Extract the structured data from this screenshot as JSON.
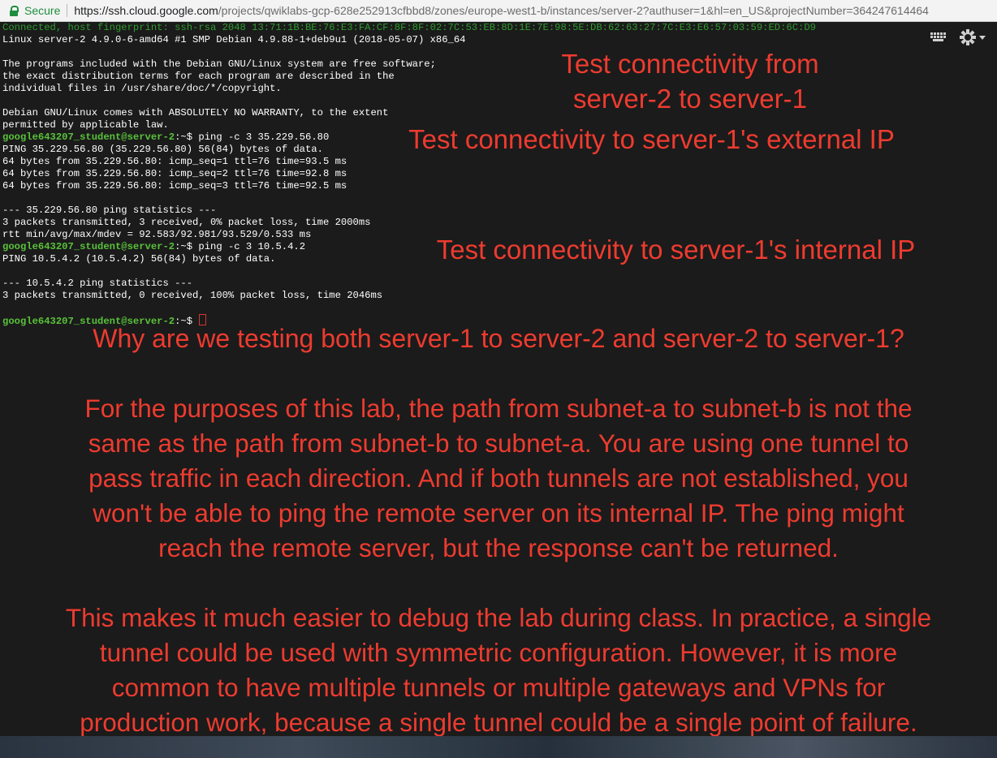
{
  "browser": {
    "secure_label": "Secure",
    "url_host": "https://ssh.cloud.google.com",
    "url_path": "/projects/qwiklabs-gcp-628e252913cfbbd8/zones/europe-west1-b/instances/server-2?authuser=1&hl=en_US&projectNumber=364247614464"
  },
  "terminal": {
    "fingerprint": "Connected, host fingerprint: ssh-rsa 2048 13:71:1B:BE:76:E3:FA:CF:8F:8F:02:7C:53:EB:8D:1E:7E:98:5E:DB:62:63:27:7C:E3:E6:57:03:59:ED:6C:D9",
    "uname": "Linux server-2 4.9.0-6-amd64 #1 SMP Debian 4.9.88-1+deb9u1 (2018-05-07) x86_64",
    "motd1": "The programs included with the Debian GNU/Linux system are free software;",
    "motd2": "the exact distribution terms for each program are described in the",
    "motd3": "individual files in /usr/share/doc/*/copyright.",
    "motd4": "Debian GNU/Linux comes with ABSOLUTELY NO WARRANTY, to the extent",
    "motd5": "permitted by applicable law.",
    "prompt": "google643207_student@server-2",
    "prompt_suffix": ":~$",
    "cmd1": " ping -c 3 35.229.56.80",
    "ping1_header": "PING 35.229.56.80 (35.229.56.80) 56(84) bytes of data.",
    "ping1_r1": "64 bytes from 35.229.56.80: icmp_seq=1 ttl=76 time=93.5 ms",
    "ping1_r2": "64 bytes from 35.229.56.80: icmp_seq=2 ttl=76 time=92.8 ms",
    "ping1_r3": "64 bytes from 35.229.56.80: icmp_seq=3 ttl=76 time=92.5 ms",
    "ping1_stats_head": "--- 35.229.56.80 ping statistics ---",
    "ping1_stats": "3 packets transmitted, 3 received, 0% packet loss, time 2000ms",
    "ping1_rtt": "rtt min/avg/max/mdev = 92.583/92.981/93.529/0.533 ms",
    "cmd2": " ping -c 3 10.5.4.2",
    "ping2_header": "PING 10.5.4.2 (10.5.4.2) 56(84) bytes of data.",
    "ping2_stats_head": "--- 10.5.4.2 ping statistics ---",
    "ping2_stats": "3 packets transmitted, 0 received, 100% packet loss, time 2046ms"
  },
  "annotations": {
    "title_line1": "Test connectivity from",
    "title_line2": "server-2 to server-1",
    "external": "Test connectivity to server-1's external IP",
    "internal": "Test connectivity to server-1's internal IP",
    "why": "Why are we testing both server-1 to server-2 and server-2 to server-1?",
    "para1": [
      "For the purposes of this lab, the path from subnet-a to subnet-b is not the",
      "same as the path from subnet-b to subnet-a. You are using one tunnel to",
      "pass traffic in each direction. And if both tunnels are not established, you",
      "won't be able to ping the remote server on its internal IP. The ping might",
      "reach the remote server, but the response can't be returned."
    ],
    "para2": [
      "This makes it much easier to debug the lab during class. In practice, a single",
      "tunnel could be used with symmetric configuration. However, it is more",
      "common to have multiple tunnels or multiple gateways and VPNs for",
      "production work, because a single tunnel could be a single point of failure."
    ]
  },
  "icons": {
    "keyboard": "keyboard-icon",
    "settings": "gear-icon"
  },
  "colors": {
    "annotation": "#ee3b2f",
    "prompt": "#59c23a",
    "terminal_bg": "#1b1b1b",
    "secure": "#1e8e3e"
  }
}
